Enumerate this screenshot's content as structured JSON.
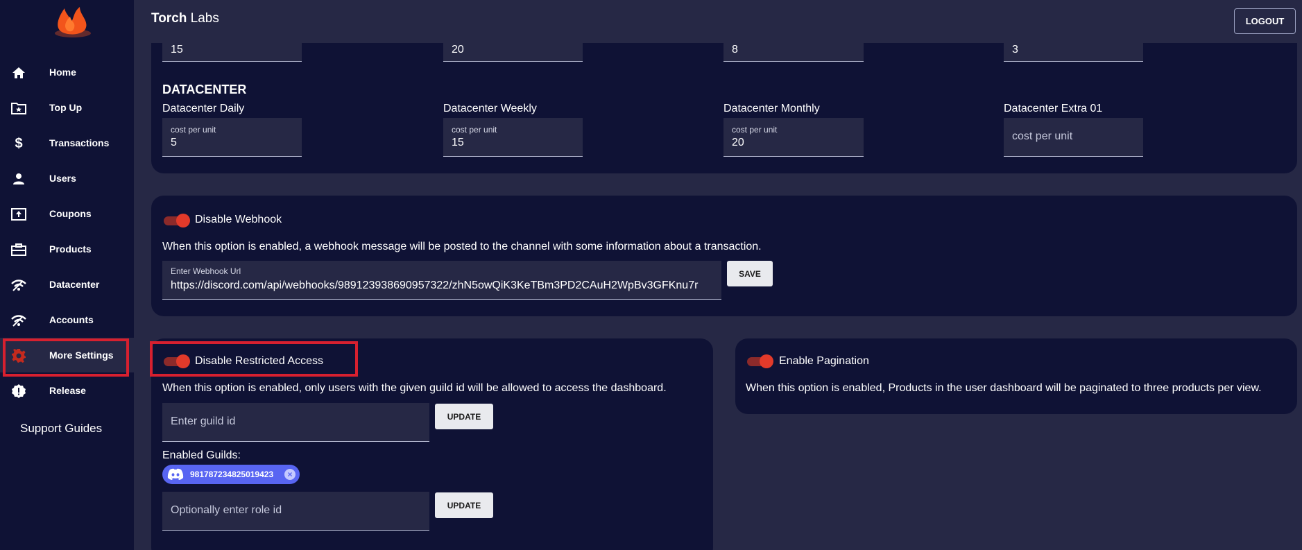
{
  "app": {
    "brand_bold": "Torch",
    "brand_rest": " Labs",
    "logout": "LOGOUT"
  },
  "sidebar": {
    "items": [
      {
        "label": "Home",
        "icon": "home-icon"
      },
      {
        "label": "Top Up",
        "icon": "folder-star-icon"
      },
      {
        "label": "Transactions",
        "icon": "dollar-icon"
      },
      {
        "label": "Users",
        "icon": "user-icon"
      },
      {
        "label": "Coupons",
        "icon": "upload-box-icon"
      },
      {
        "label": "Products",
        "icon": "briefcase-icon"
      },
      {
        "label": "Datacenter",
        "icon": "wifi-icon"
      },
      {
        "label": "Accounts",
        "icon": "wifi-icon"
      },
      {
        "label": "More Settings",
        "icon": "gear-icon"
      },
      {
        "label": "Release",
        "icon": "alert-badge-icon"
      }
    ],
    "support": "Support Guides"
  },
  "prices_top": {
    "values": [
      "15",
      "20",
      "8",
      "3"
    ]
  },
  "datacenter": {
    "title": "DATACENTER",
    "fields": [
      {
        "label": "Datacenter Daily",
        "small": "cost per unit",
        "value": "5"
      },
      {
        "label": "Datacenter Weekly",
        "small": "cost per unit",
        "value": "15"
      },
      {
        "label": "Datacenter Monthly",
        "small": "cost per unit",
        "value": "20"
      },
      {
        "label": "Datacenter Extra 01",
        "placeholder": "cost per unit"
      }
    ]
  },
  "webhook": {
    "toggle_label": "Disable Webhook",
    "description": "When this option is enabled, a webhook message will be posted to the channel with some information about a transaction.",
    "field_small": "Enter Webhook Url",
    "field_value": "https://discord.com/api/webhooks/989123938690957322/zhN5owQiK3KeTBm3PD2CAuH2WpBv3GFKnu7r",
    "save": "SAVE"
  },
  "restricted": {
    "toggle_label": "Disable Restricted Access",
    "description": "When this option is enabled, only users with the given guild id will be allowed to access the dashboard.",
    "guild_placeholder": "Enter guild id",
    "update": "UPDATE",
    "enabled_guilds_label": "Enabled Guilds:",
    "guild_chip": "981787234825019423",
    "role_placeholder": "Optionally enter role id",
    "update2": "UPDATE"
  },
  "pagination": {
    "toggle_label": "Enable Pagination",
    "description": "When this option is enabled, Products in the user dashboard will be paginated to three products per view."
  },
  "colors": {
    "accent": "#e23a2a",
    "highlight": "#d7202f",
    "discord": "#5865f2"
  }
}
